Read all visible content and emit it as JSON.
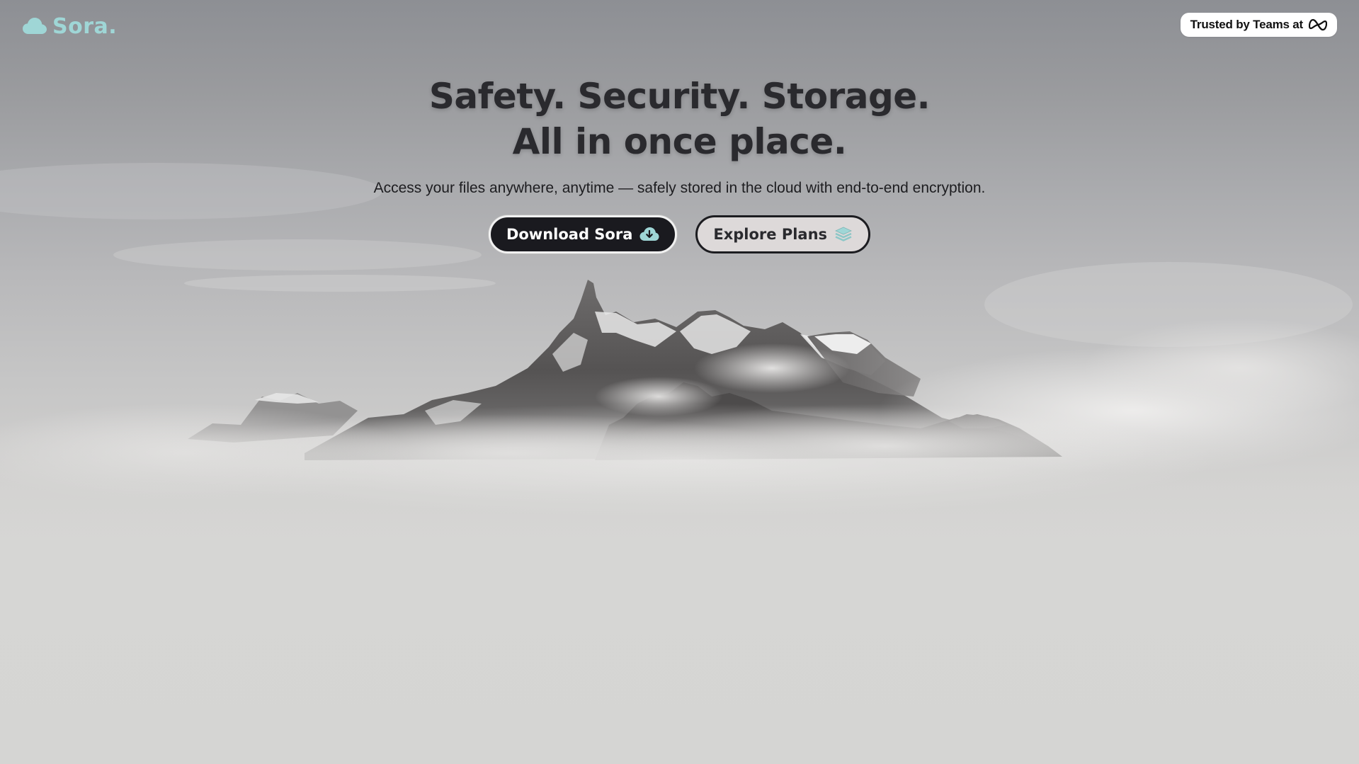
{
  "header": {
    "logo_text": "Sora.",
    "logo_icon": "cloud-icon",
    "trust_badge": {
      "text": "Trusted by Teams at",
      "icon": "meta-logo-icon"
    }
  },
  "hero": {
    "headline_line1": "Safety. Security. Storage.",
    "headline_line2": "All in once place.",
    "subtitle": "Access your files anywhere, anytime — safely stored in the cloud with end-to-end encryption.",
    "buttons": [
      {
        "label": "Download Sora",
        "icon": "cloud-download-icon"
      },
      {
        "label": "Explore Plans",
        "icon": "layers-icon"
      }
    ]
  },
  "colors": {
    "brand": "#9fd6d6",
    "button_dark": "#1a1a1f",
    "button_light": "#ddd9d9",
    "text_dark": "#2a2a2e"
  }
}
